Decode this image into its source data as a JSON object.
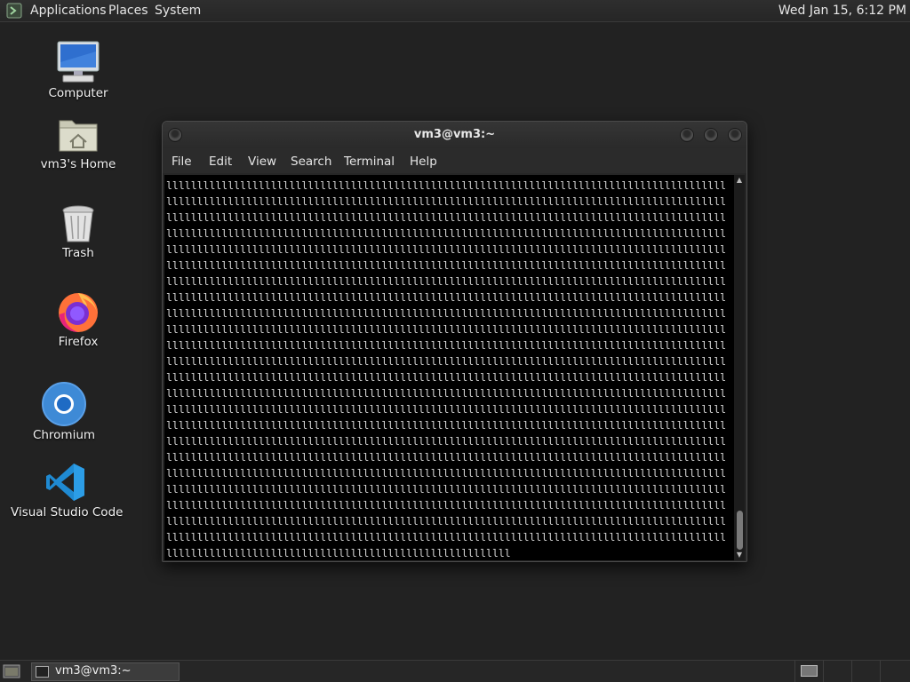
{
  "top_panel": {
    "menus": [
      "Applications",
      "Places",
      "System"
    ],
    "clock": "Wed Jan 15,  6:12 PM"
  },
  "desktop_icons": [
    {
      "label": "Computer",
      "icon": "computer-icon"
    },
    {
      "label": "vm3's Home",
      "icon": "home-folder-icon"
    },
    {
      "label": "Trash",
      "icon": "trash-icon"
    },
    {
      "label": "Firefox",
      "icon": "firefox-icon"
    },
    {
      "label": "Chromium",
      "icon": "chromium-icon"
    },
    {
      "label": "Visual Studio Code",
      "icon": "vscode-icon"
    }
  ],
  "window": {
    "title": "vm3@vm3:~",
    "menu": [
      "File",
      "Edit",
      "View",
      "Search",
      "Terminal",
      "Help"
    ]
  },
  "terminal": {
    "repeated_char": "l",
    "full_line_count": 23,
    "chars_per_full_line": 91,
    "last_line_chars": 56
  },
  "taskbar": {
    "task_label": "vm3@vm3:~",
    "workspace_count": 4,
    "active_workspace": 1
  },
  "colors": {
    "desktop_bg": "#222222",
    "terminal_bg": "#000000",
    "terminal_fg": "#d8d8d8"
  }
}
